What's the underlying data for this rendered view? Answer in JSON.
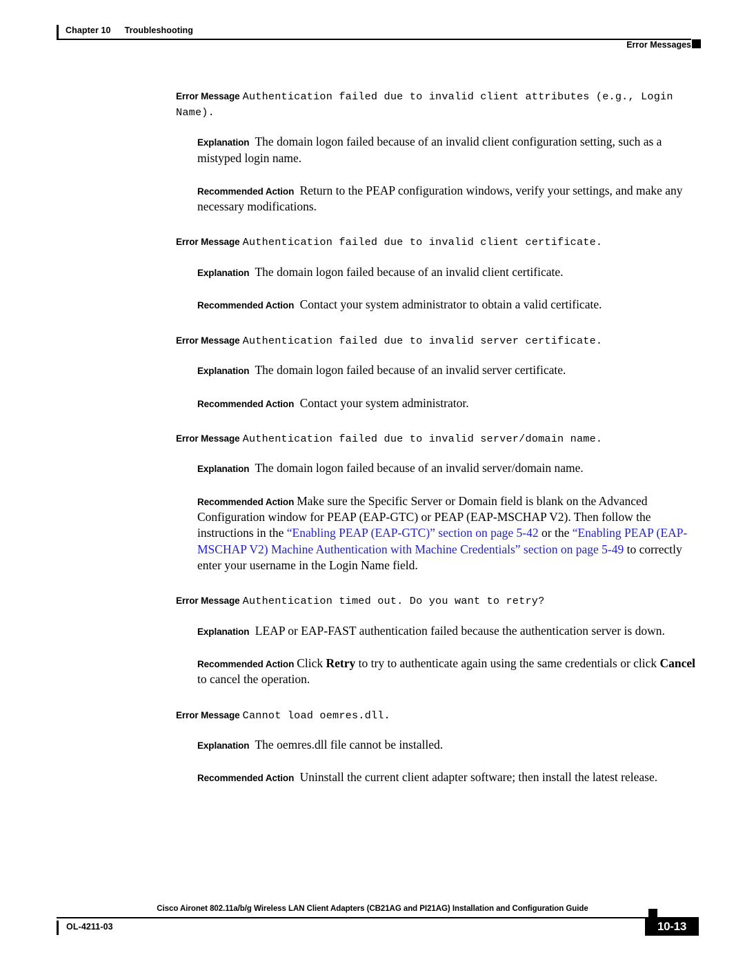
{
  "header": {
    "chapter_number": "Chapter 10",
    "chapter_title": "Troubleshooting",
    "section_title": "Error Messages"
  },
  "labels": {
    "error_message": "Error Message",
    "explanation": "Explanation",
    "recommended_action": "Recommended Action"
  },
  "colors": {
    "link": "#2222CC",
    "text": "#000000",
    "rule": "#000000"
  },
  "blocks": [
    {
      "id": "invalid-client-attributes",
      "message": "Authentication failed due to invalid client attributes (e.g., Login Name).",
      "explanation": "The domain logon failed because of an invalid client configuration setting, such as a mistyped login name.",
      "recommended_action": "Return to the PEAP configuration windows, verify your settings, and make any necessary modifications."
    },
    {
      "id": "invalid-client-certificate",
      "message": "Authentication failed due to invalid client certificate.",
      "explanation": "The domain logon failed because of an invalid client certificate.",
      "recommended_action": "Contact your system administrator to obtain a valid certificate."
    },
    {
      "id": "invalid-server-certificate",
      "message": "Authentication failed due to invalid server certificate.",
      "explanation": "The domain logon failed because of an invalid server certificate.",
      "recommended_action": "Contact your system administrator."
    },
    {
      "id": "invalid-server-domain-name",
      "message": "Authentication failed due to invalid server/domain name.",
      "explanation": "The domain logon failed because of an invalid server/domain name.",
      "recommended_action_parts": {
        "part1": "Make sure the Specific Server or Domain field is blank on the Advanced Configuration window for PEAP (EAP-GTC) or PEAP (EAP-MSCHAP V2). Then follow the instructions in the ",
        "link1": "“Enabling PEAP (EAP-GTC)” section on page 5-42",
        "part2": " or the ",
        "link2": "“Enabling PEAP (EAP-MSCHAP V2) Machine Authentication with Machine Credentials” section on page 5-49",
        "part3": " to correctly enter your username in the Login Name field."
      }
    },
    {
      "id": "authentication-timed-out",
      "message": "Authentication timed out. Do you want to retry?",
      "explanation": "LEAP or EAP-FAST authentication failed because the authentication server is down.",
      "recommended_action_parts": {
        "part1": "Click ",
        "bold1": "Retry",
        "part2": " to try to authenticate again using the same credentials or click ",
        "bold2": "Cancel",
        "part3": " to cancel the operation."
      }
    },
    {
      "id": "cannot-load-oemres-dll",
      "message": "Cannot load oemres.dll.",
      "explanation": "The oemres.dll file cannot be installed.",
      "recommended_action": "Uninstall the current client adapter software; then install the latest release."
    }
  ],
  "footer": {
    "guide_title": "Cisco Aironet 802.11a/b/g Wireless LAN Client Adapters (CB21AG and PI21AG) Installation and Configuration Guide",
    "document_id": "OL-4211-03",
    "page_number": "10-13"
  }
}
